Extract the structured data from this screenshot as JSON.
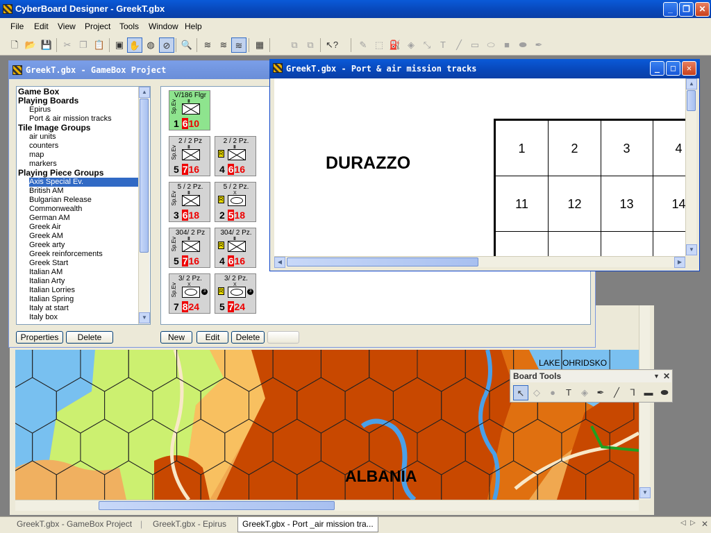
{
  "app": {
    "title": "CyberBoard Designer - GreekT.gbx"
  },
  "menu": [
    "File",
    "Edit",
    "View",
    "Project",
    "Tools",
    "Window",
    "Help"
  ],
  "toolbar_icons": [
    "new-file-icon",
    "open-folder-icon",
    "save-icon",
    "cut-icon",
    "copy-icon",
    "paste-icon",
    "board-icon",
    "move-icon",
    "color-icon",
    "eraser-icon",
    "zoom-icon",
    "layer-1-icon",
    "layer-2-icon",
    "layer-3-icon",
    "grid-icon",
    "raise-icon",
    "lower-icon",
    "help-arrow-icon",
    "pencil-icon",
    "select-rect-icon",
    "fill-icon",
    "paint-icon",
    "arrow-tool-icon",
    "text-icon",
    "line-icon",
    "rect-icon",
    "ellipse-icon",
    "filled-rect-icon",
    "filled-ellipse-icon",
    "dropper-icon"
  ],
  "project_window": {
    "title": "GreekT.gbx - GameBox Project",
    "tree": [
      {
        "label": "Game Box",
        "type": "hdr"
      },
      {
        "label": "Playing Boards",
        "type": "hdr"
      },
      {
        "label": "Epirus",
        "type": "sub"
      },
      {
        "label": "Port & air mission tracks",
        "type": "sub"
      },
      {
        "label": "Tile Image Groups",
        "type": "hdr"
      },
      {
        "label": "air units",
        "type": "sub"
      },
      {
        "label": "counters",
        "type": "sub"
      },
      {
        "label": "map",
        "type": "sub"
      },
      {
        "label": "markers",
        "type": "sub"
      },
      {
        "label": "Playing Piece Groups",
        "type": "hdr"
      },
      {
        "label": "Axis Special Ev.",
        "type": "sub",
        "selected": true
      },
      {
        "label": "British AM",
        "type": "sub"
      },
      {
        "label": "Bulgarian Release",
        "type": "sub"
      },
      {
        "label": "Commonwealth",
        "type": "sub"
      },
      {
        "label": "German AM",
        "type": "sub"
      },
      {
        "label": "Greek Air",
        "type": "sub"
      },
      {
        "label": "Greek AM",
        "type": "sub"
      },
      {
        "label": "Greek arty",
        "type": "sub"
      },
      {
        "label": "Greek reinforcements",
        "type": "sub"
      },
      {
        "label": "Greek Start",
        "type": "sub"
      },
      {
        "label": "Italian AM",
        "type": "sub"
      },
      {
        "label": "Italian Arty",
        "type": "sub"
      },
      {
        "label": "Italian Lorries",
        "type": "sub"
      },
      {
        "label": "Italian Spring",
        "type": "sub"
      },
      {
        "label": "Italy at start",
        "type": "sub"
      },
      {
        "label": "Italy box",
        "type": "sub"
      }
    ],
    "left_buttons": [
      "Properties",
      "Delete"
    ],
    "right_buttons": [
      "New",
      "Edit",
      "Delete"
    ],
    "pieces": [
      {
        "top": "V/186 Flgr",
        "sp": "Sp.Ev",
        "a": "1",
        "b": "6",
        "c": "10",
        "green": true,
        "r": false,
        "oval": false
      },
      {
        "top": "2 / 2 Pz",
        "sp": "Sp.Ev",
        "a": "5",
        "b": "7",
        "c": "16",
        "green": false,
        "r": false,
        "oval": false
      },
      {
        "top": "2 / 2 Pz.",
        "sp": "",
        "a": "4",
        "b": "6",
        "c": "16",
        "green": false,
        "r": true,
        "oval": false
      },
      {
        "top": "5 / 2 Pz.",
        "sp": "Sp.Ev",
        "a": "3",
        "b": "6",
        "c": "18",
        "green": false,
        "r": false,
        "oval": false
      },
      {
        "top": "5 / 2 Pz.",
        "sp": "",
        "a": "2",
        "b": "5",
        "c": "18",
        "green": false,
        "r": true,
        "oval": true
      },
      {
        "top": "304/ 2 Pz",
        "sp": "Sp.Ev",
        "a": "5",
        "b": "7",
        "c": "16",
        "green": false,
        "r": false,
        "oval": false
      },
      {
        "top": "304/ 2 Pz.",
        "sp": "",
        "a": "4",
        "b": "6",
        "c": "16",
        "green": false,
        "r": true,
        "oval": false
      },
      {
        "top": "3/ 2 Pz.",
        "sp": "Sp.Ev",
        "a": "7",
        "b": "8",
        "c": "24",
        "green": false,
        "r": false,
        "oval": true,
        "dot": "3"
      },
      {
        "top": "3/ 2 Pz.",
        "sp": "",
        "a": "5",
        "b": "7",
        "c": "24",
        "green": false,
        "r": true,
        "oval": true,
        "dot": "3"
      }
    ]
  },
  "track_window": {
    "title": "GreekT.gbx - Port & air mission tracks",
    "label": "DURAZZO",
    "row1": [
      "1",
      "2",
      "3",
      "4"
    ],
    "row2": [
      "11",
      "12",
      "13",
      "14"
    ]
  },
  "map_window": {
    "labels": {
      "albania": "ALBANIA",
      "lake": "LAKE OHRIDSKO"
    }
  },
  "board_tools": {
    "title": "Board Tools",
    "icons": [
      "select-arrow-icon",
      "eraser-icon",
      "fill-icon",
      "text-icon",
      "brush-icon",
      "dropper-icon",
      "line-icon",
      "lineset-icon",
      "rect-icon",
      "ellipse-icon"
    ]
  },
  "tabs": [
    "GreekT.gbx - GameBox Project",
    "GreekT.gbx - Epirus",
    "GreekT.gbx - Port _air mission tra..."
  ]
}
